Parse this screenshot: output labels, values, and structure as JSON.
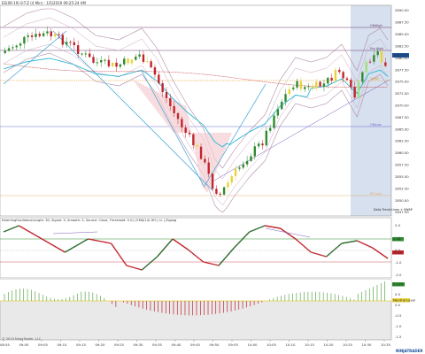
{
  "header": {
    "title": "ES(09-19) 0-T-Z (4 Min) - 1/5/2019 09:25:24 AM"
  },
  "main_chart": {
    "price_ticks": [
      "2890.00",
      "2887.50",
      "2885.00",
      "2882.50",
      "2880.00",
      "2877.50",
      "2875.00",
      "2872.50",
      "2870.00",
      "2867.50",
      "2865.00",
      "2862.50",
      "2860.00",
      "2857.50",
      "2855.00",
      "2852.50",
      "2850.00",
      "2847.50"
    ],
    "last_price": "2883.50",
    "line_labels": {
      "pdh": "ONHigh",
      "hod": "Pre High",
      "vwap": "VWAP",
      "poc": "ONLow",
      "pdl": "PD Low"
    },
    "session_label": "Daily Trend Lines + VWAP"
  },
  "osc_panel": {
    "title": "EaterlingOscillator(Length: 30, Signal: 9, Smooth: 3, Source: Close, Threshold: 0.0) | EMA(14) HH | LL | Zigzag",
    "ticks": [
      "2.0",
      "1.0",
      "0.0",
      "-1.0",
      "-2.0"
    ],
    "badge_green": "0.46",
    "badge_red": "-0.12"
  },
  "hist_panel": {
    "ticks": [
      "1.0",
      "0.5",
      "0.0",
      "-0.5",
      "-1.0",
      "-1.5"
    ],
    "badge_green": "0.154",
    "zero_label": "Neutral Level"
  },
  "time_axis": [
    "08:55",
    "09:00",
    "09:05",
    "09:10",
    "09:15",
    "09:20",
    "09:25",
    "09:30",
    "09:35",
    "09:40",
    "09:45",
    "09:50",
    "09:55",
    "10:00",
    "10:05",
    "10:10",
    "10:15",
    "10:20",
    "10:25",
    "10:30",
    "10:35"
  ],
  "footer": {
    "copyright": "© 2019 NinjaTrader, LLC",
    "brand": "NINJATRADER"
  },
  "colors": {
    "up": "#2e8b2e",
    "down": "#c0262e",
    "neutral_yellow": "#e8d23a",
    "vwap": "#29b6d6",
    "band": "#7a4f7a",
    "session_shade": "#d6e0ee"
  }
}
